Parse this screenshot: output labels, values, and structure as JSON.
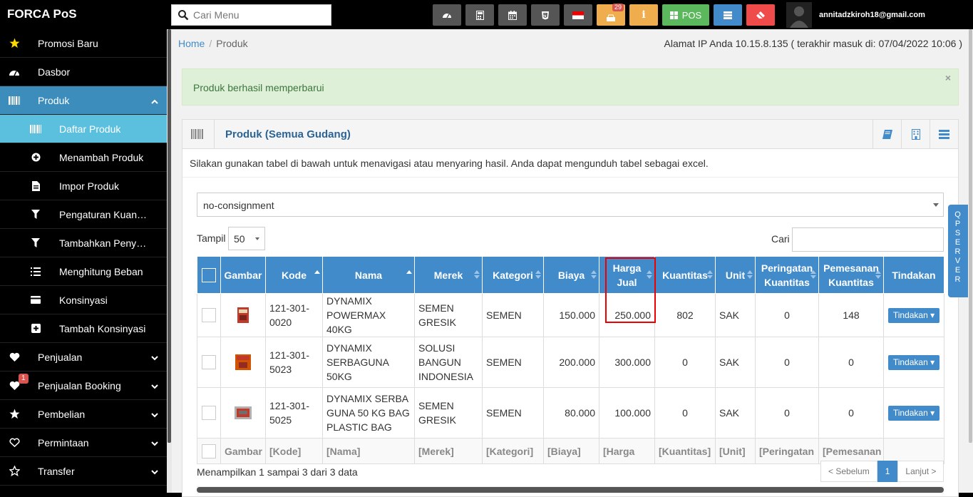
{
  "brand": "FORCA PoS",
  "search": {
    "placeholder": "Cari Menu"
  },
  "topbar": {
    "notif_count": "29",
    "pos_label": "POS",
    "user_email": "annitadzkiroh18@gmail.com"
  },
  "sidebar": {
    "items": [
      {
        "label": "Promosi Baru",
        "icon": "star-icon"
      },
      {
        "label": "Dasbor",
        "icon": "dashboard-icon"
      },
      {
        "label": "Produk",
        "icon": "barcode-icon"
      },
      {
        "label": "Daftar Produk",
        "icon": "barcode-icon"
      },
      {
        "label": "Menambah Produk",
        "icon": "plus-circle-icon"
      },
      {
        "label": "Impor Produk",
        "icon": "file-icon"
      },
      {
        "label": "Pengaturan Kuantitas",
        "icon": "filter-icon"
      },
      {
        "label": "Tambahkan Penyesuaian",
        "icon": "filter-icon"
      },
      {
        "label": "Menghitung Beban",
        "icon": "list-icon"
      },
      {
        "label": "Konsinyasi",
        "icon": "card-icon"
      },
      {
        "label": "Tambah Konsinyasi",
        "icon": "plus-square-icon"
      },
      {
        "label": "Penjualan",
        "icon": "heart-icon"
      },
      {
        "label": "Penjualan Booking",
        "icon": "heart-icon",
        "badge": "1"
      },
      {
        "label": "Pembelian",
        "icon": "star-icon"
      },
      {
        "label": "Permintaan",
        "icon": "heart-outline-icon"
      },
      {
        "label": "Transfer",
        "icon": "star-outline-icon"
      }
    ]
  },
  "breadcrumb": {
    "home": "Home",
    "current": "Produk"
  },
  "ip_info": "Alamat IP Anda 10.15.8.135 ( terakhir masuk di: 07/04/2022 10:06 )",
  "alert": {
    "message": "Produk berhasil memperbarui",
    "close": "×"
  },
  "box": {
    "title": "Produk (Semua Gudang)",
    "intro": "Silakan gunakan tabel di bawah untuk menavigasi atau menyaring hasil. Anda dapat mengunduh tabel sebagai excel."
  },
  "filter": {
    "selected": "no-consignment"
  },
  "length": {
    "label": "Tampil",
    "value": "50"
  },
  "search_table": {
    "label": "Cari"
  },
  "table": {
    "headers": [
      "Gambar",
      "Kode",
      "Nama",
      "Merek",
      "Kategori",
      "Biaya",
      "Harga Jual",
      "Kuantitas",
      "Unit",
      "Peringatan Kuantitas",
      "Pemesanan Kuantitas",
      "Tindakan"
    ],
    "rows": [
      {
        "kode": "121-301-0020",
        "nama": "DYNAMIX POWERMAX 40KG",
        "merek": "SEMEN GRESIK",
        "kategori": "SEMEN",
        "biaya": "150.000",
        "harga": "250.000",
        "kuantitas": "802",
        "unit": "SAK",
        "peringatan": "0",
        "pemesanan": "148",
        "tindakan": "Tindakan"
      },
      {
        "kode": "121-301-5023",
        "nama": "DYNAMIX SERBAGUNA 50KG",
        "merek": "SOLUSI BANGUN INDONESIA",
        "kategori": "SEMEN",
        "biaya": "200.000",
        "harga": "300.000",
        "kuantitas": "0",
        "unit": "SAK",
        "peringatan": "0",
        "pemesanan": "0",
        "tindakan": "Tindakan"
      },
      {
        "kode": "121-301-5025",
        "nama": "DYNAMIX SERBA GUNA 50 KG BAG PLASTIC BAG",
        "merek": "SEMEN GRESIK",
        "kategori": "SEMEN",
        "biaya": "80.000",
        "harga": "100.000",
        "kuantitas": "0",
        "unit": "SAK",
        "peringatan": "0",
        "pemesanan": "0",
        "tindakan": "Tindakan"
      }
    ],
    "footer": [
      "Gambar",
      "[Kode]",
      "[Nama]",
      "[Merek]",
      "[Kategori]",
      "[Biaya]",
      "[Harga",
      "[Kuantitas]",
      "[Unit]",
      "[Peringatan",
      "[Pemesanan"
    ]
  },
  "showing": "Menampilkan 1 sampai 3 dari 3 data",
  "pager": {
    "prev": "< Sebelum",
    "page": "1",
    "next": "Lanjut >"
  },
  "qp_server": "QP SERVER"
}
